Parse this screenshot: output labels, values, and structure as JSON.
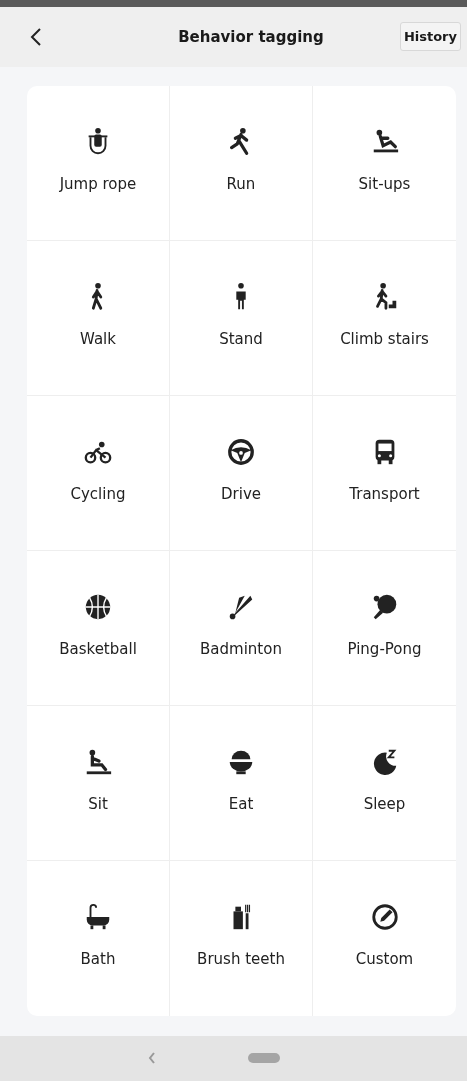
{
  "header": {
    "title": "Behavior tagging",
    "action": "History"
  },
  "behaviors": [
    {
      "label": "Jump rope"
    },
    {
      "label": "Run"
    },
    {
      "label": "Sit-ups"
    },
    {
      "label": "Walk"
    },
    {
      "label": "Stand"
    },
    {
      "label": "Climb stairs"
    },
    {
      "label": "Cycling"
    },
    {
      "label": "Drive"
    },
    {
      "label": "Transport"
    },
    {
      "label": "Basketball"
    },
    {
      "label": "Badminton"
    },
    {
      "label": "Ping-Pong"
    },
    {
      "label": "Sit"
    },
    {
      "label": "Eat"
    },
    {
      "label": "Sleep"
    },
    {
      "label": "Bath"
    },
    {
      "label": "Brush teeth"
    },
    {
      "label": "Custom"
    }
  ]
}
